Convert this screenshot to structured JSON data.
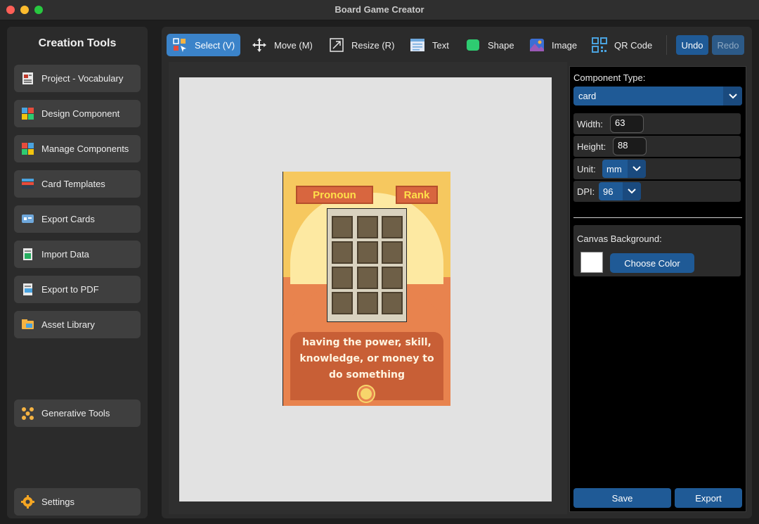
{
  "window": {
    "title": "Board Game Creator"
  },
  "sidebar": {
    "title": "Creation Tools",
    "items": [
      {
        "label": "Project - Vocabulary",
        "icon": "project-icon"
      },
      {
        "label": "Design Component",
        "icon": "design-component-icon"
      },
      {
        "label": "Manage Components",
        "icon": "manage-components-icon"
      },
      {
        "label": "Card Templates",
        "icon": "card-templates-icon"
      },
      {
        "label": "Export Cards",
        "icon": "export-cards-icon"
      },
      {
        "label": "Import Data",
        "icon": "import-data-icon"
      },
      {
        "label": "Export to PDF",
        "icon": "export-pdf-icon"
      },
      {
        "label": "Asset Library",
        "icon": "asset-library-icon"
      }
    ],
    "generative": {
      "label": "Generative Tools",
      "icon": "generative-tools-icon"
    },
    "settings": {
      "label": "Settings",
      "icon": "gear-icon"
    }
  },
  "toolbar": {
    "tools": [
      {
        "label": "Select (V)",
        "icon": "select-tool-icon",
        "active": true
      },
      {
        "label": "Move (M)",
        "icon": "move-tool-icon"
      },
      {
        "label": "Resize (R)",
        "icon": "resize-tool-icon"
      },
      {
        "label": "Text",
        "icon": "text-tool-icon"
      },
      {
        "label": "Shape",
        "icon": "shape-tool-icon"
      },
      {
        "label": "Image",
        "icon": "image-tool-icon"
      },
      {
        "label": "QR Code",
        "icon": "qr-code-icon"
      }
    ],
    "undo": "Undo",
    "redo": "Redo"
  },
  "card": {
    "left_banner": "Pronoun",
    "right_banner": "Rank",
    "text_lines": [
      "having the power, skill,",
      "knowledge, or money to",
      "do something"
    ],
    "colors": {
      "body": "#e8834e",
      "top": "#f6c85f",
      "banner_text": "#ffe04a"
    }
  },
  "properties": {
    "component_type_label": "Component Type:",
    "component_type": "card",
    "width_label": "Width:",
    "width": "63",
    "height_label": "Height:",
    "height": "88",
    "unit_label": "Unit:",
    "unit": "mm",
    "dpi_label": "DPI:",
    "dpi": "96",
    "canvas_bg_label": "Canvas Background:",
    "canvas_bg_color": "#ffffff",
    "choose_color": "Choose Color",
    "save": "Save",
    "export": "Export"
  },
  "colors": {
    "accent": "#1f5a96",
    "active_tool": "#3b83c9"
  }
}
